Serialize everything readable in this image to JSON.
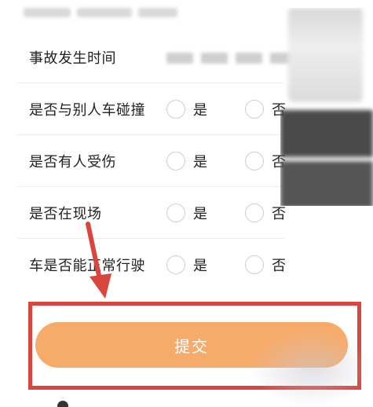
{
  "form": {
    "rows": [
      {
        "label": "事故发生时间"
      },
      {
        "label": "是否与别人车碰撞",
        "yes": "是",
        "no": "否"
      },
      {
        "label": "是否有人受伤",
        "yes": "是",
        "no": "否"
      },
      {
        "label": "是否在现场",
        "yes": "是",
        "no": "否"
      },
      {
        "label": "车是否能正常行驶",
        "yes": "是",
        "no": "否"
      }
    ]
  },
  "submit": {
    "label": "提交"
  },
  "colors": {
    "button": "#f7ab6b",
    "highlight_frame": "#d9453f",
    "arrow": "#d9453f"
  }
}
